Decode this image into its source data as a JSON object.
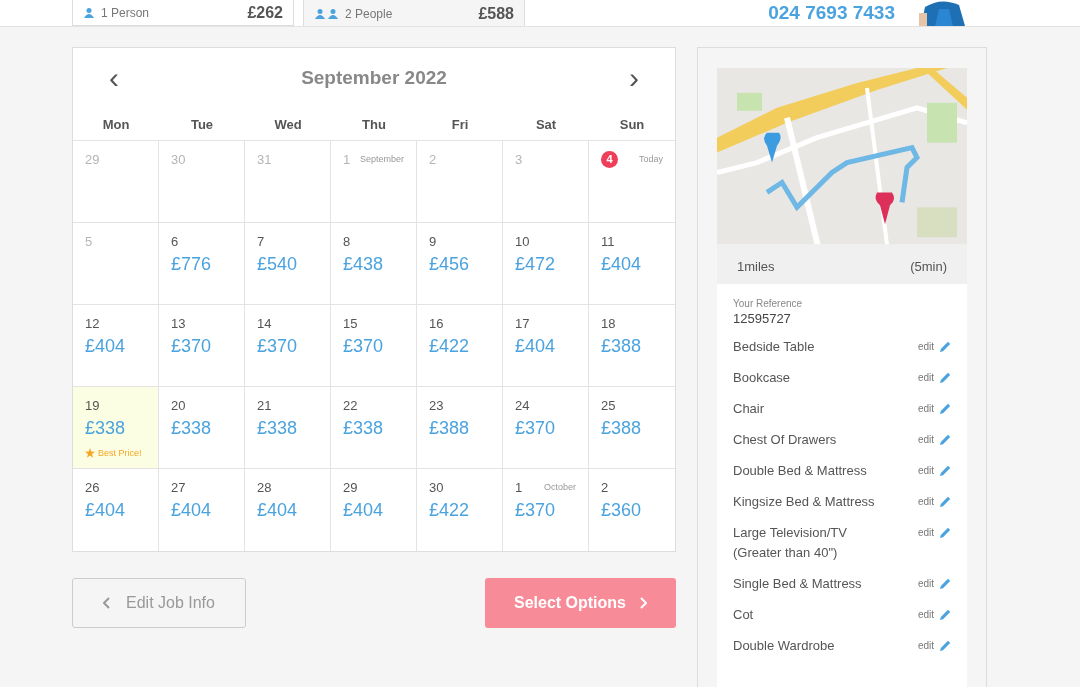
{
  "options": [
    {
      "label": "1 Person",
      "price": "£262",
      "selected": false,
      "kind": "single"
    },
    {
      "label": "2 People",
      "price": "£588",
      "selected": true,
      "kind": "couple"
    }
  ],
  "phone": "024 7693 7433",
  "calendar": {
    "title": "September 2022",
    "prev": "‹",
    "next": "›",
    "weekdays": [
      "Mon",
      "Tue",
      "Wed",
      "Thu",
      "Fri",
      "Sat",
      "Sun"
    ],
    "weeks": [
      [
        {
          "day": "29",
          "past": true
        },
        {
          "day": "30",
          "past": true
        },
        {
          "day": "31",
          "past": true
        },
        {
          "day": "1",
          "month": "September",
          "past": true
        },
        {
          "day": "2",
          "past": true
        },
        {
          "day": "3",
          "past": true
        },
        {
          "day": "4",
          "today": "Today"
        }
      ],
      [
        {
          "day": "5",
          "past": true
        },
        {
          "day": "6",
          "price": "£776",
          "past": false
        },
        {
          "day": "7",
          "price": "£540",
          "past": false
        },
        {
          "day": "8",
          "price": "£438",
          "past": false
        },
        {
          "day": "9",
          "price": "£456",
          "past": false
        },
        {
          "day": "10",
          "price": "£472",
          "past": false
        },
        {
          "day": "11",
          "price": "£404",
          "past": false
        }
      ],
      [
        {
          "day": "12",
          "price": "£404",
          "past": false
        },
        {
          "day": "13",
          "price": "£370",
          "past": false
        },
        {
          "day": "14",
          "price": "£370",
          "past": false
        },
        {
          "day": "15",
          "price": "£370",
          "past": false
        },
        {
          "day": "16",
          "price": "£422",
          "past": false
        },
        {
          "day": "17",
          "price": "£404",
          "past": false
        },
        {
          "day": "18",
          "price": "£388",
          "past": false
        }
      ],
      [
        {
          "day": "19",
          "price": "£338",
          "past": false,
          "best": "Best Price!"
        },
        {
          "day": "20",
          "price": "£338",
          "past": false
        },
        {
          "day": "21",
          "price": "£338",
          "past": false
        },
        {
          "day": "22",
          "price": "£338",
          "past": false
        },
        {
          "day": "23",
          "price": "£388",
          "past": false
        },
        {
          "day": "24",
          "price": "£370",
          "past": false
        },
        {
          "day": "25",
          "price": "£388",
          "past": false
        }
      ],
      [
        {
          "day": "26",
          "price": "£404",
          "past": false
        },
        {
          "day": "27",
          "price": "£404",
          "past": false
        },
        {
          "day": "28",
          "price": "£404",
          "past": false
        },
        {
          "day": "29",
          "price": "£404",
          "past": false
        },
        {
          "day": "30",
          "price": "£422",
          "past": false
        },
        {
          "day": "1",
          "month": "October",
          "price": "£370",
          "past": false
        },
        {
          "day": "2",
          "price": "£360",
          "past": false
        }
      ]
    ]
  },
  "back_button": "Edit Job Info",
  "next_button": "Select Options",
  "route": {
    "distance": "1miles",
    "duration": "(5min)"
  },
  "reference": {
    "label": "Your Reference",
    "value": "12595727"
  },
  "items": [
    {
      "name": "Bedside Table",
      "action": "edit"
    },
    {
      "name": "Bookcase",
      "action": "edit"
    },
    {
      "name": "Chair",
      "action": "edit"
    },
    {
      "name": "Chest Of Drawers",
      "action": "edit"
    },
    {
      "name": "Double Bed & Mattress",
      "action": "edit"
    },
    {
      "name": "Kingsize Bed & Mattress",
      "action": "edit"
    },
    {
      "name": "Large Television/TV (Greater than 40\")",
      "action": "edit"
    },
    {
      "name": "Single Bed & Mattress",
      "action": "edit"
    },
    {
      "name": "Cot",
      "action": "edit"
    },
    {
      "name": "Double Wardrobe",
      "action": "edit"
    }
  ]
}
